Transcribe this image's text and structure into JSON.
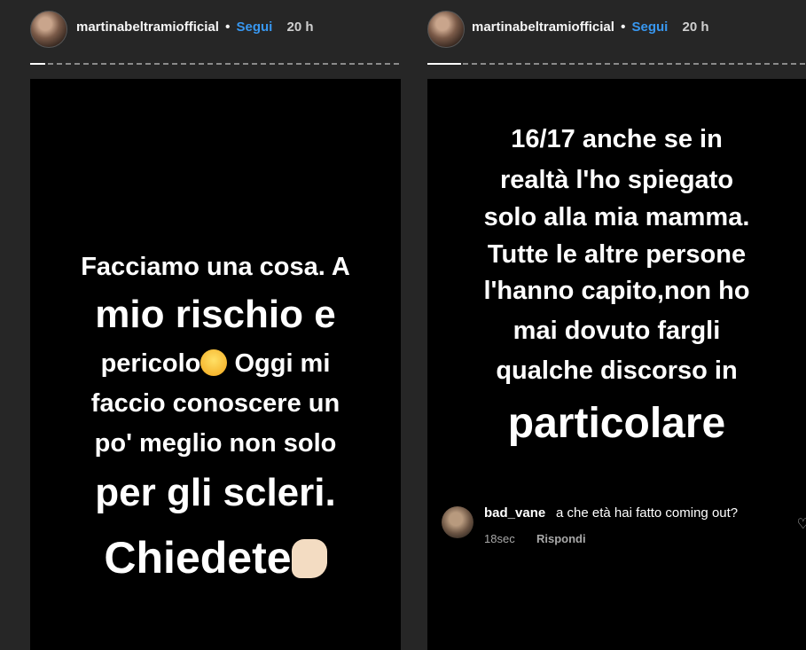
{
  "stories": [
    {
      "username": "martinabeltramiofficial",
      "separator": "•",
      "follow_label": "Segui",
      "time": "20 h",
      "progress": 0.02,
      "lines": [
        "Facciamo una cosa. A",
        "mio rischio e",
        "pericolo",
        "Oggi mi",
        "faccio conoscere un",
        "po' meglio non solo",
        "per gli scleri.",
        "Chiedete"
      ]
    },
    {
      "username": "martinabeltramiofficial",
      "separator": "•",
      "follow_label": "Segui",
      "time": "20 h",
      "progress": 0.09,
      "lines": [
        "16/17 anche se in",
        "realtà l'ho spiegato",
        "solo alla mia mamma.",
        "Tutte le altre persone",
        "l'hanno capito,non ho",
        "mai dovuto fargli",
        "qualche discorso in",
        "particolare"
      ],
      "comment": {
        "user": "bad_vane",
        "text": "a che età hai fatto coming out?",
        "age": "18sec",
        "reply_label": "Rispondi"
      }
    }
  ],
  "icons": {
    "left_emoji": "face-with-tears-of-joy-icon",
    "left_hand": "sign-of-horns-icon",
    "heart": "heart-icon"
  }
}
